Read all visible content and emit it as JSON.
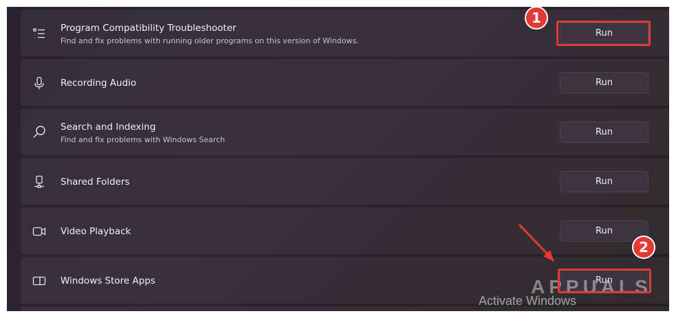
{
  "troubleshooters": [
    {
      "title": "Program Compatibility Troubleshooter",
      "description": "Find and fix problems with running older programs on this version of Windows.",
      "icon": "list-icon",
      "button": "Run"
    },
    {
      "title": "Recording Audio",
      "description": "",
      "icon": "microphone-icon",
      "button": "Run"
    },
    {
      "title": "Search and Indexing",
      "description": "Find and fix problems with Windows Search",
      "icon": "search-icon",
      "button": "Run"
    },
    {
      "title": "Shared Folders",
      "description": "",
      "icon": "network-drive-icon",
      "button": "Run"
    },
    {
      "title": "Video Playback",
      "description": "",
      "icon": "video-camera-icon",
      "button": "Run"
    },
    {
      "title": "Windows Store Apps",
      "description": "",
      "icon": "app-window-icon",
      "button": "Run"
    }
  ],
  "annotations": {
    "step1": "1",
    "step2": "2",
    "highlight_color": "#e13a3a",
    "badge_color": "#e53935"
  },
  "watermark": {
    "activate": "Activate Windows",
    "logo": "APPUALS"
  }
}
